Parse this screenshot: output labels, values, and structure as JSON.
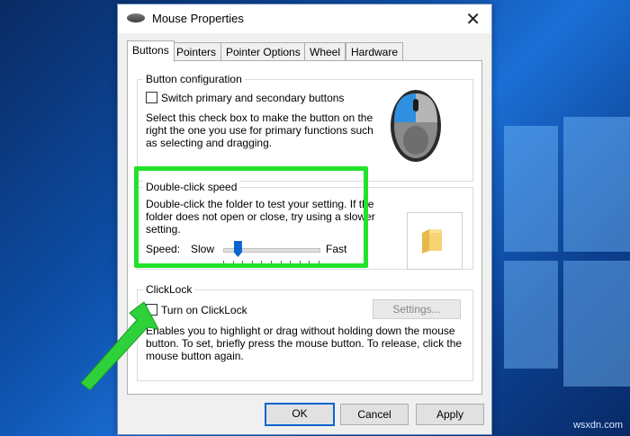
{
  "window": {
    "title": "Mouse Properties",
    "close_glyph": "✕"
  },
  "tabs": [
    {
      "label": "Buttons"
    },
    {
      "label": "Pointers"
    },
    {
      "label": "Pointer Options"
    },
    {
      "label": "Wheel"
    },
    {
      "label": "Hardware"
    }
  ],
  "button_config": {
    "title": "Button configuration",
    "checkbox_label": "Switch primary and secondary buttons",
    "desc_line1": "Select this check box to make the button on the",
    "desc_line2": "right the one you use for primary functions such",
    "desc_line3": "as selecting and dragging."
  },
  "double_click": {
    "title": "Double-click speed",
    "desc_line1": "Double-click the folder to test your setting. If the",
    "desc_line2": "folder does not open or close, try using a slower",
    "desc_line3": "setting.",
    "speed_label": "Speed:",
    "slow_label": "Slow",
    "fast_label": "Fast",
    "slider_value": 0.15
  },
  "clicklock": {
    "title": "ClickLock",
    "checkbox_label": "Turn on ClickLock",
    "settings_label": "Settings...",
    "desc_line1": "Enables you to highlight or drag without holding down the mouse",
    "desc_line2": "button. To set, briefly press the mouse button. To release, click the",
    "desc_line3": "mouse button again."
  },
  "buttons": {
    "ok": "OK",
    "cancel": "Cancel",
    "apply": "Apply"
  },
  "watermark": "wsxdn.com",
  "colors": {
    "highlight": "#22e22b",
    "accent": "#0a64d0",
    "arrow": "#2fd13a"
  }
}
